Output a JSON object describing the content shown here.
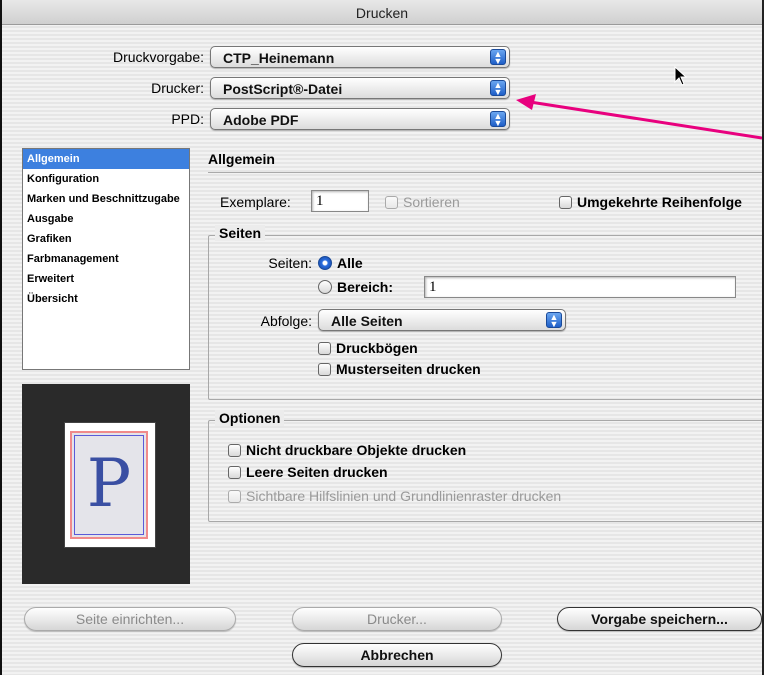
{
  "window": {
    "title": "Drucken"
  },
  "top": {
    "preset_label": "Druckvorgabe:",
    "preset_value": "CTP_Heinemann",
    "printer_label": "Drucker:",
    "printer_value": "PostScript®-Datei",
    "ppd_label": "PPD:",
    "ppd_value": "Adobe PDF"
  },
  "sidebar": {
    "items": [
      {
        "label": "Allgemein",
        "selected": true
      },
      {
        "label": "Konfiguration"
      },
      {
        "label": "Marken und Beschnittzugabe"
      },
      {
        "label": "Ausgabe"
      },
      {
        "label": "Grafiken"
      },
      {
        "label": "Farbmanagement"
      },
      {
        "label": "Erweitert"
      },
      {
        "label": "Übersicht"
      }
    ]
  },
  "preview": {
    "letter": "P"
  },
  "main": {
    "title": "Allgemein",
    "copies_label": "Exemplare:",
    "copies_value": "1",
    "collate_label": "Sortieren",
    "reverse_label": "Umgekehrte Reihenfolge"
  },
  "pages": {
    "legend": "Seiten",
    "pages_label": "Seiten:",
    "all_label": "Alle",
    "range_label": "Bereich:",
    "range_value": "1",
    "sequence_label": "Abfolge:",
    "sequence_value": "Alle Seiten",
    "spreads_label": "Druckbögen",
    "master_label": "Musterseiten drucken"
  },
  "options": {
    "legend": "Optionen",
    "nonprint_label": "Nicht druckbare Objekte drucken",
    "blank_label": "Leere Seiten drucken",
    "guides_label": "Sichtbare Hilfslinien und Grundlinienraster drucken"
  },
  "buttons": {
    "page_setup": "Seite einrichten...",
    "printer": "Drucker...",
    "save_preset": "Vorgabe speichern...",
    "cancel": "Abbrechen"
  },
  "colors": {
    "annotation_arrow": "#e8007e",
    "selection": "#3d80df"
  }
}
